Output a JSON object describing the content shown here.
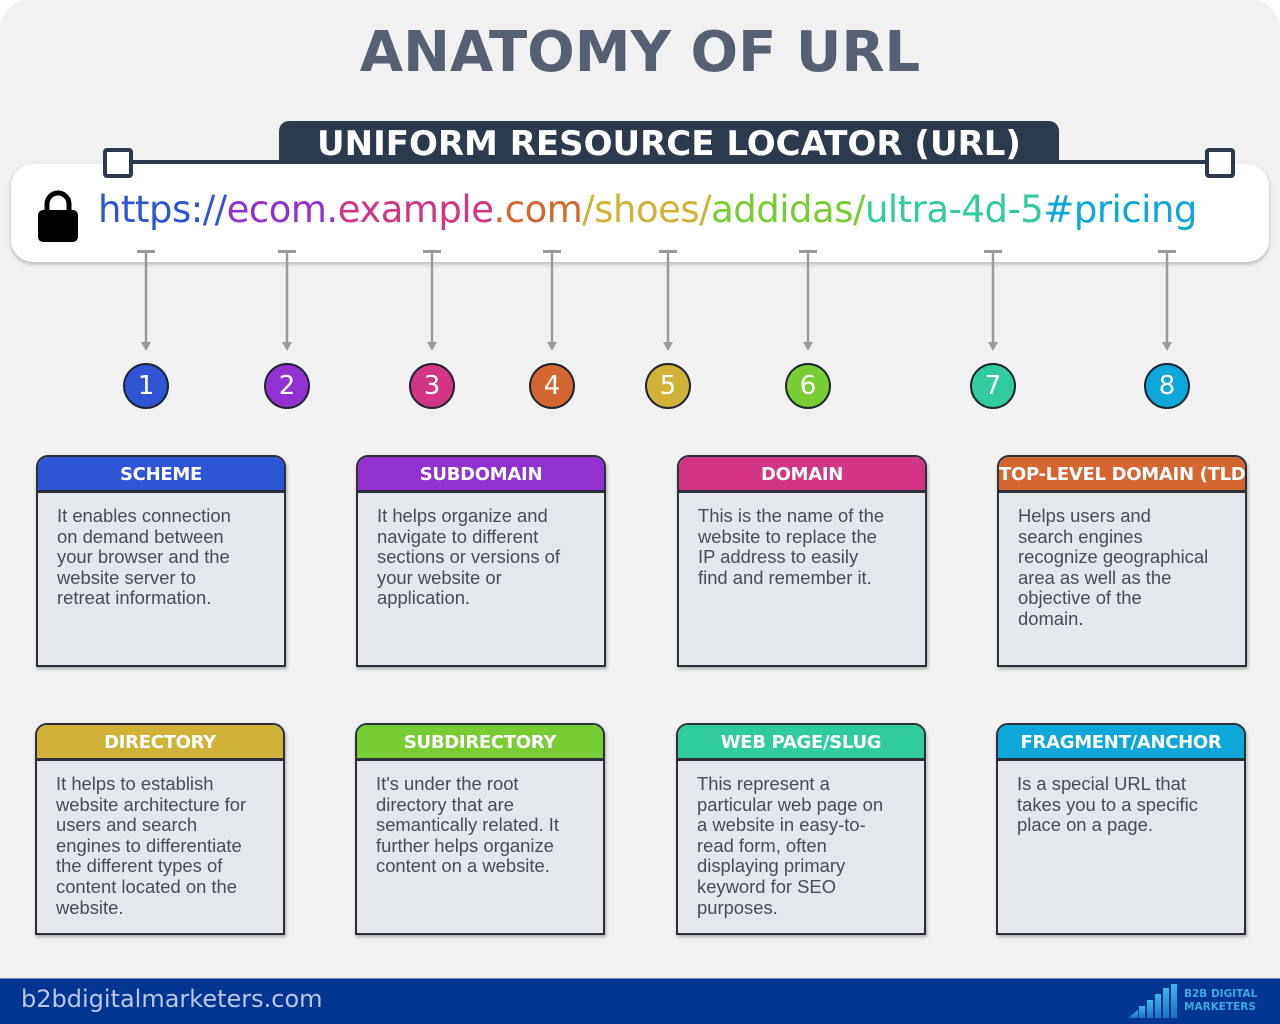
{
  "title": "ANATOMY OF URL",
  "subtitle": "UNIFORM RESOURCE LOCATOR (URL)",
  "url_bar": {
    "lock_icon": "lock-icon",
    "segments": [
      {
        "text": "https://",
        "color": "#2f55d4",
        "part": 1
      },
      {
        "text": "ecom.",
        "color": "#9230d0",
        "part": 2
      },
      {
        "text": "example",
        "color": "#d13584",
        "part": 3
      },
      {
        "text": ".com",
        "color": "#d46630",
        "part": 4
      },
      {
        "text": "/shoes/",
        "color": "#cfb237",
        "part": 5
      },
      {
        "text": "addidas/",
        "color": "#78cc34",
        "part": 6
      },
      {
        "text": "ultra-4d-5",
        "color": "#31cc9e",
        "part": 7
      },
      {
        "text": "#pricing",
        "color": "#0da7d9",
        "part": 8
      }
    ]
  },
  "steps": [
    {
      "number": "1",
      "color": "#2f55d4"
    },
    {
      "number": "2",
      "color": "#9230d0"
    },
    {
      "number": "3",
      "color": "#d13584"
    },
    {
      "number": "4",
      "color": "#d46630"
    },
    {
      "number": "5",
      "color": "#cfb237"
    },
    {
      "number": "6",
      "color": "#78cc34"
    },
    {
      "number": "7",
      "color": "#31cc9e"
    },
    {
      "number": "8",
      "color": "#0da7d9"
    }
  ],
  "cards": [
    {
      "title": "SCHEME",
      "color": "#2f55d4",
      "lines": [
        "It enables connection",
        "on demand between",
        "your browser and the",
        "website server to",
        "retreat information."
      ]
    },
    {
      "title": "SUBDOMAIN",
      "color": "#9230d0",
      "lines": [
        "It helps organize and",
        "navigate to different",
        "sections or versions of",
        "your website or",
        "application."
      ]
    },
    {
      "title": "DOMAIN",
      "color": "#d13584",
      "lines": [
        "This is the name of the",
        "website to replace the",
        "IP address to easily",
        "find and remember it."
      ]
    },
    {
      "title": "TOP-LEVEL DOMAIN (TLD)",
      "color": "#d46630",
      "lines": [
        "Helps users and",
        "search engines",
        "recognize geographical",
        "area as well as the",
        "objective of the",
        "domain."
      ]
    },
    {
      "title": "DIRECTORY",
      "color": "#cfb237",
      "lines": [
        "It helps to establish",
        "website architecture for",
        "users and search",
        "engines to differentiate",
        "the different types of",
        "content located on the",
        "website."
      ]
    },
    {
      "title": "SUBDIRECTORY",
      "color": "#78cc34",
      "lines": [
        "It's under the root",
        "directory that are",
        "semantically related. It",
        "further helps organize",
        "content on a website."
      ]
    },
    {
      "title": "WEB PAGE/SLUG",
      "color": "#31cc9e",
      "lines": [
        "This represent a",
        "particular web page on",
        "a website in easy-to-",
        "read form, often",
        "displaying primary",
        "keyword for SEO",
        "purposes."
      ]
    },
    {
      "title": "FRAGMENT/ANCHOR",
      "color": "#0da7d9",
      "lines": [
        "Is a special URL that",
        "takes you to a specific",
        "place on a page."
      ]
    }
  ],
  "footer": {
    "site": "b2bdigitalmarketers.com",
    "logo_line1": "B2B DIGITAL",
    "logo_line2": "MARKETERS",
    "background": "#003592"
  }
}
